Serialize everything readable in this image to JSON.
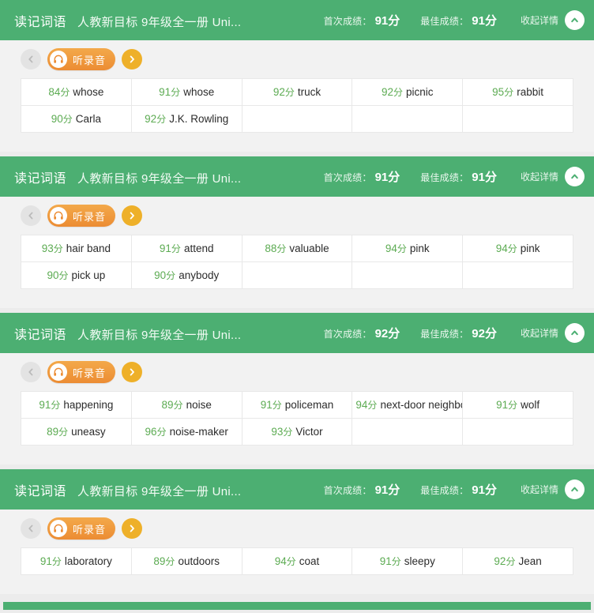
{
  "colors": {
    "header_green": "#4caf72",
    "score_green": "#5cab52",
    "listen_orange": "#ec8c33",
    "next_arrow_amber": "#eeb029",
    "page_bg": "#ececec",
    "card_bg": "#f2f2f2"
  },
  "labels": {
    "first_score_label": "首次成绩：",
    "best_score_label": "最佳成绩：",
    "collapse_label": "收起详情",
    "listen_label": "听录音",
    "score_unit": "分"
  },
  "sections": [
    {
      "title": "读记词语",
      "subtitle": "人教新目标 9年级全一册 Uni...",
      "first_score": "91分",
      "best_score": "91分",
      "columns": 5,
      "rows": [
        [
          {
            "score": "84",
            "unit": "分",
            "word": "whose"
          },
          {
            "score": "91",
            "unit": "分",
            "word": "whose"
          },
          {
            "score": "92",
            "unit": "分",
            "word": "truck"
          },
          {
            "score": "92",
            "unit": "分",
            "word": "picnic"
          },
          {
            "score": "95",
            "unit": "分",
            "word": "rabbit"
          }
        ],
        [
          {
            "score": "90",
            "unit": "分",
            "word": "Carla"
          },
          {
            "score": "92",
            "unit": "分",
            "word": "J.K. Rowling"
          },
          null,
          null,
          null
        ]
      ]
    },
    {
      "title": "读记词语",
      "subtitle": "人教新目标 9年级全一册 Uni...",
      "first_score": "91分",
      "best_score": "91分",
      "columns": 5,
      "rows": [
        [
          {
            "score": "93",
            "unit": "分",
            "word": "hair band"
          },
          {
            "score": "91",
            "unit": "分",
            "word": "attend"
          },
          {
            "score": "88",
            "unit": "分",
            "word": "valuable"
          },
          {
            "score": "94",
            "unit": "分",
            "word": "pink"
          },
          {
            "score": "94",
            "unit": "分",
            "word": "pink"
          }
        ],
        [
          {
            "score": "90",
            "unit": "分",
            "word": "pick up"
          },
          {
            "score": "90",
            "unit": "分",
            "word": "anybody"
          },
          null,
          null,
          null
        ]
      ]
    },
    {
      "title": "读记词语",
      "subtitle": "人教新目标 9年级全一册 Uni...",
      "first_score": "92分",
      "best_score": "92分",
      "columns": 5,
      "rows": [
        [
          {
            "score": "91",
            "unit": "分",
            "word": "happening"
          },
          {
            "score": "89",
            "unit": "分",
            "word": "noise"
          },
          {
            "score": "91",
            "unit": "分",
            "word": "policeman"
          },
          {
            "score": "94",
            "unit": "分",
            "word": "next-door neighbor"
          },
          {
            "score": "91",
            "unit": "分",
            "word": "wolf"
          }
        ],
        [
          {
            "score": "89",
            "unit": "分",
            "word": "uneasy"
          },
          {
            "score": "96",
            "unit": "分",
            "word": "noise-maker"
          },
          {
            "score": "93",
            "unit": "分",
            "word": "Victor"
          },
          null,
          null
        ]
      ]
    },
    {
      "title": "读记词语",
      "subtitle": "人教新目标 9年级全一册 Uni...",
      "first_score": "91分",
      "best_score": "91分",
      "columns": 5,
      "rows": [
        [
          {
            "score": "91",
            "unit": "分",
            "word": "laboratory"
          },
          {
            "score": "89",
            "unit": "分",
            "word": "outdoors"
          },
          {
            "score": "94",
            "unit": "分",
            "word": "coat"
          },
          {
            "score": "91",
            "unit": "分",
            "word": "sleepy"
          },
          {
            "score": "92",
            "unit": "分",
            "word": "Jean"
          }
        ]
      ]
    }
  ],
  "icons": {
    "collapse": "chevron-up-icon",
    "prev": "chevron-left-icon",
    "next": "chevron-right-icon",
    "listen": "headphone-icon"
  }
}
